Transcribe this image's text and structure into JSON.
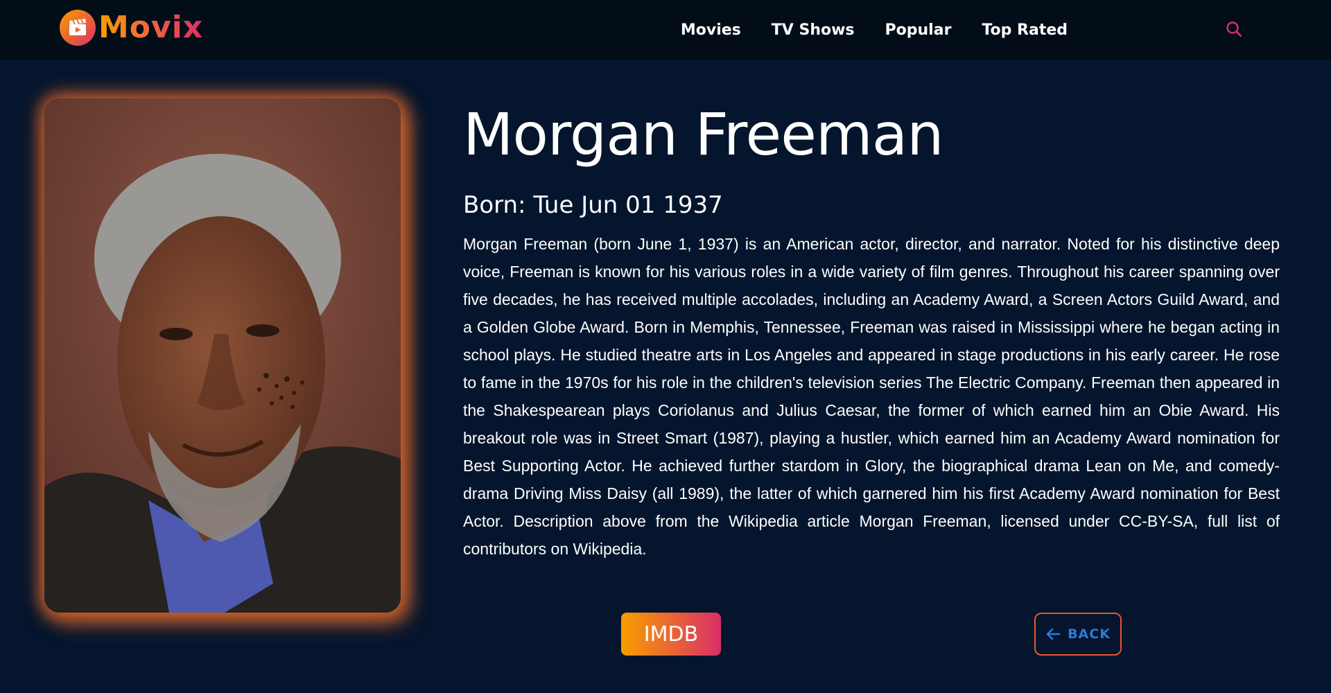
{
  "app": {
    "logo_text": "Movix"
  },
  "nav": {
    "items": [
      "Movies",
      "TV Shows",
      "Popular",
      "Top Rated"
    ]
  },
  "person": {
    "name": "Morgan Freeman",
    "born": "Born: Tue Jun 01 1937",
    "biography": "Morgan Freeman (born June 1, 1937) is an American actor, director, and narrator. Noted for his distinctive deep voice, Freeman is known for his various roles in a wide variety of film genres. Throughout his career spanning over five decades, he has received multiple accolades, including an Academy Award, a Screen Actors Guild Award, and a Golden Globe Award. Born in Memphis, Tennessee, Freeman was raised in Mississippi where he began acting in school plays. He studied theatre arts in Los Angeles and appeared in stage productions in his early career. He rose to fame in the 1970s for his role in the children's television series The Electric Company. Freeman then appeared in the Shakespearean plays Coriolanus and Julius Caesar, the former of which earned him an Obie Award. His breakout role was in Street Smart (1987), playing a hustler, which earned him an Academy Award nomination for Best Supporting Actor. He achieved further stardom in Glory, the biographical drama Lean on Me, and comedy-drama Driving Miss Daisy (all 1989), the latter of which garnered him his first Academy Award nomination for Best Actor. Description above from the Wikipedia article Morgan Freeman, licensed under CC-BY-SA, full list of contributors on Wikipedia."
  },
  "actions": {
    "imdb_label": "IMDB",
    "back_label": "BACK"
  },
  "icons": {
    "logo": "clapperboard-icon",
    "search": "search-icon",
    "back": "arrow-left-icon"
  },
  "colors": {
    "background": "#04152d",
    "header": "#020d18",
    "gradient_start": "#f89e00",
    "gradient_end": "#da2f68",
    "back_text": "#2b7bd9",
    "back_border": "#e8562c"
  }
}
